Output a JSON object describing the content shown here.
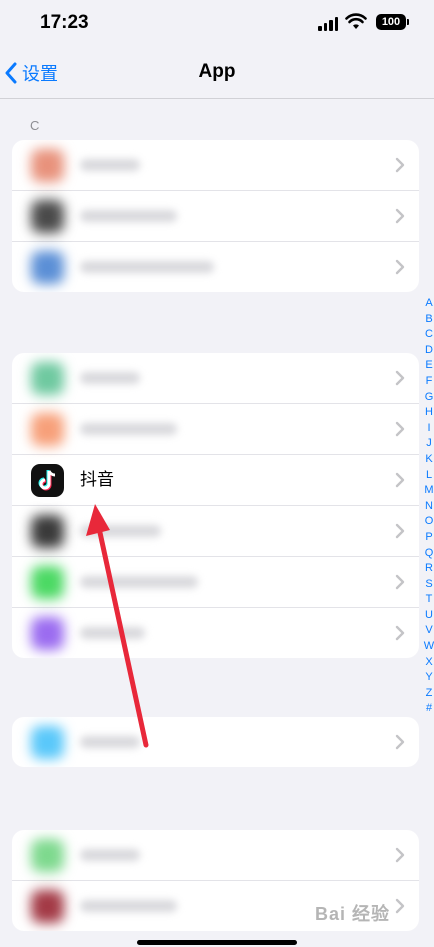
{
  "status_bar": {
    "time": "17:23",
    "battery": "100"
  },
  "nav": {
    "back_label": "设置",
    "title": "App"
  },
  "sections": [
    {
      "header": "C",
      "items": [
        {
          "label": "",
          "icon_color": "#e8927c"
        },
        {
          "label": "",
          "icon_color": "#4a4a4a"
        },
        {
          "label": "",
          "icon_color": "#5b8fd6"
        }
      ]
    },
    {
      "header": "",
      "items": [
        {
          "label": "",
          "icon_color": "#6fc9a0"
        },
        {
          "label": "",
          "icon_color": "#f7a07a"
        },
        {
          "label": "抖音",
          "icon_color": "#111111"
        },
        {
          "label": "",
          "icon_color": "#3a3a3a"
        },
        {
          "label": "",
          "icon_color": "#4cd964"
        },
        {
          "label": "",
          "icon_color": "#9b6cf0"
        }
      ]
    },
    {
      "header": "",
      "items": [
        {
          "label": "",
          "icon_color": "#5ac8fa"
        }
      ]
    },
    {
      "header": "",
      "items": [
        {
          "label": "",
          "icon_color": "#7ed98e"
        },
        {
          "label": "",
          "icon_color": "#a33a46"
        }
      ]
    }
  ],
  "index_letters": [
    "A",
    "B",
    "C",
    "D",
    "E",
    "F",
    "G",
    "H",
    "I",
    "J",
    "K",
    "L",
    "M",
    "N",
    "O",
    "P",
    "Q",
    "R",
    "S",
    "T",
    "U",
    "V",
    "W",
    "X",
    "Y",
    "Z",
    "#"
  ],
  "watermark": "Bai 经验",
  "colors": {
    "accent": "#0a7aff",
    "arrow": "#e8283a"
  }
}
